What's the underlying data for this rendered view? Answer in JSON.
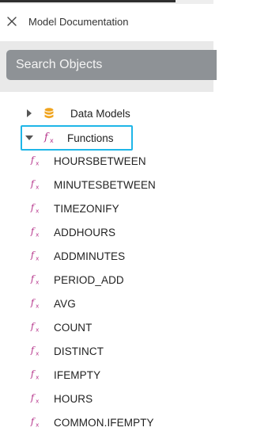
{
  "header": {
    "title": "Model Documentation",
    "close_icon": "close-icon"
  },
  "search": {
    "placeholder": "Search Objects",
    "value": ""
  },
  "tree": {
    "data_models": {
      "label": "Data Models",
      "expanded": false,
      "icon": "database-icon",
      "icon_color": "#f0a41e"
    },
    "functions": {
      "label": "Functions",
      "expanded": true,
      "selected": true,
      "icon": "function-icon",
      "icon_color": "#b5338a",
      "highlight_color": "#1fb6e8"
    },
    "function_items": [
      {
        "label": "HOURSBETWEEN"
      },
      {
        "label": "MINUTESBETWEEN"
      },
      {
        "label": "TIMEZONIFY"
      },
      {
        "label": "ADDHOURS"
      },
      {
        "label": "ADDMINUTES"
      },
      {
        "label": "PERIOD_ADD"
      },
      {
        "label": "AVG"
      },
      {
        "label": "COUNT"
      },
      {
        "label": "DISTINCT"
      },
      {
        "label": "IFEMPTY"
      },
      {
        "label": "HOURS"
      },
      {
        "label": "COMMON.IFEMPTY"
      }
    ]
  }
}
